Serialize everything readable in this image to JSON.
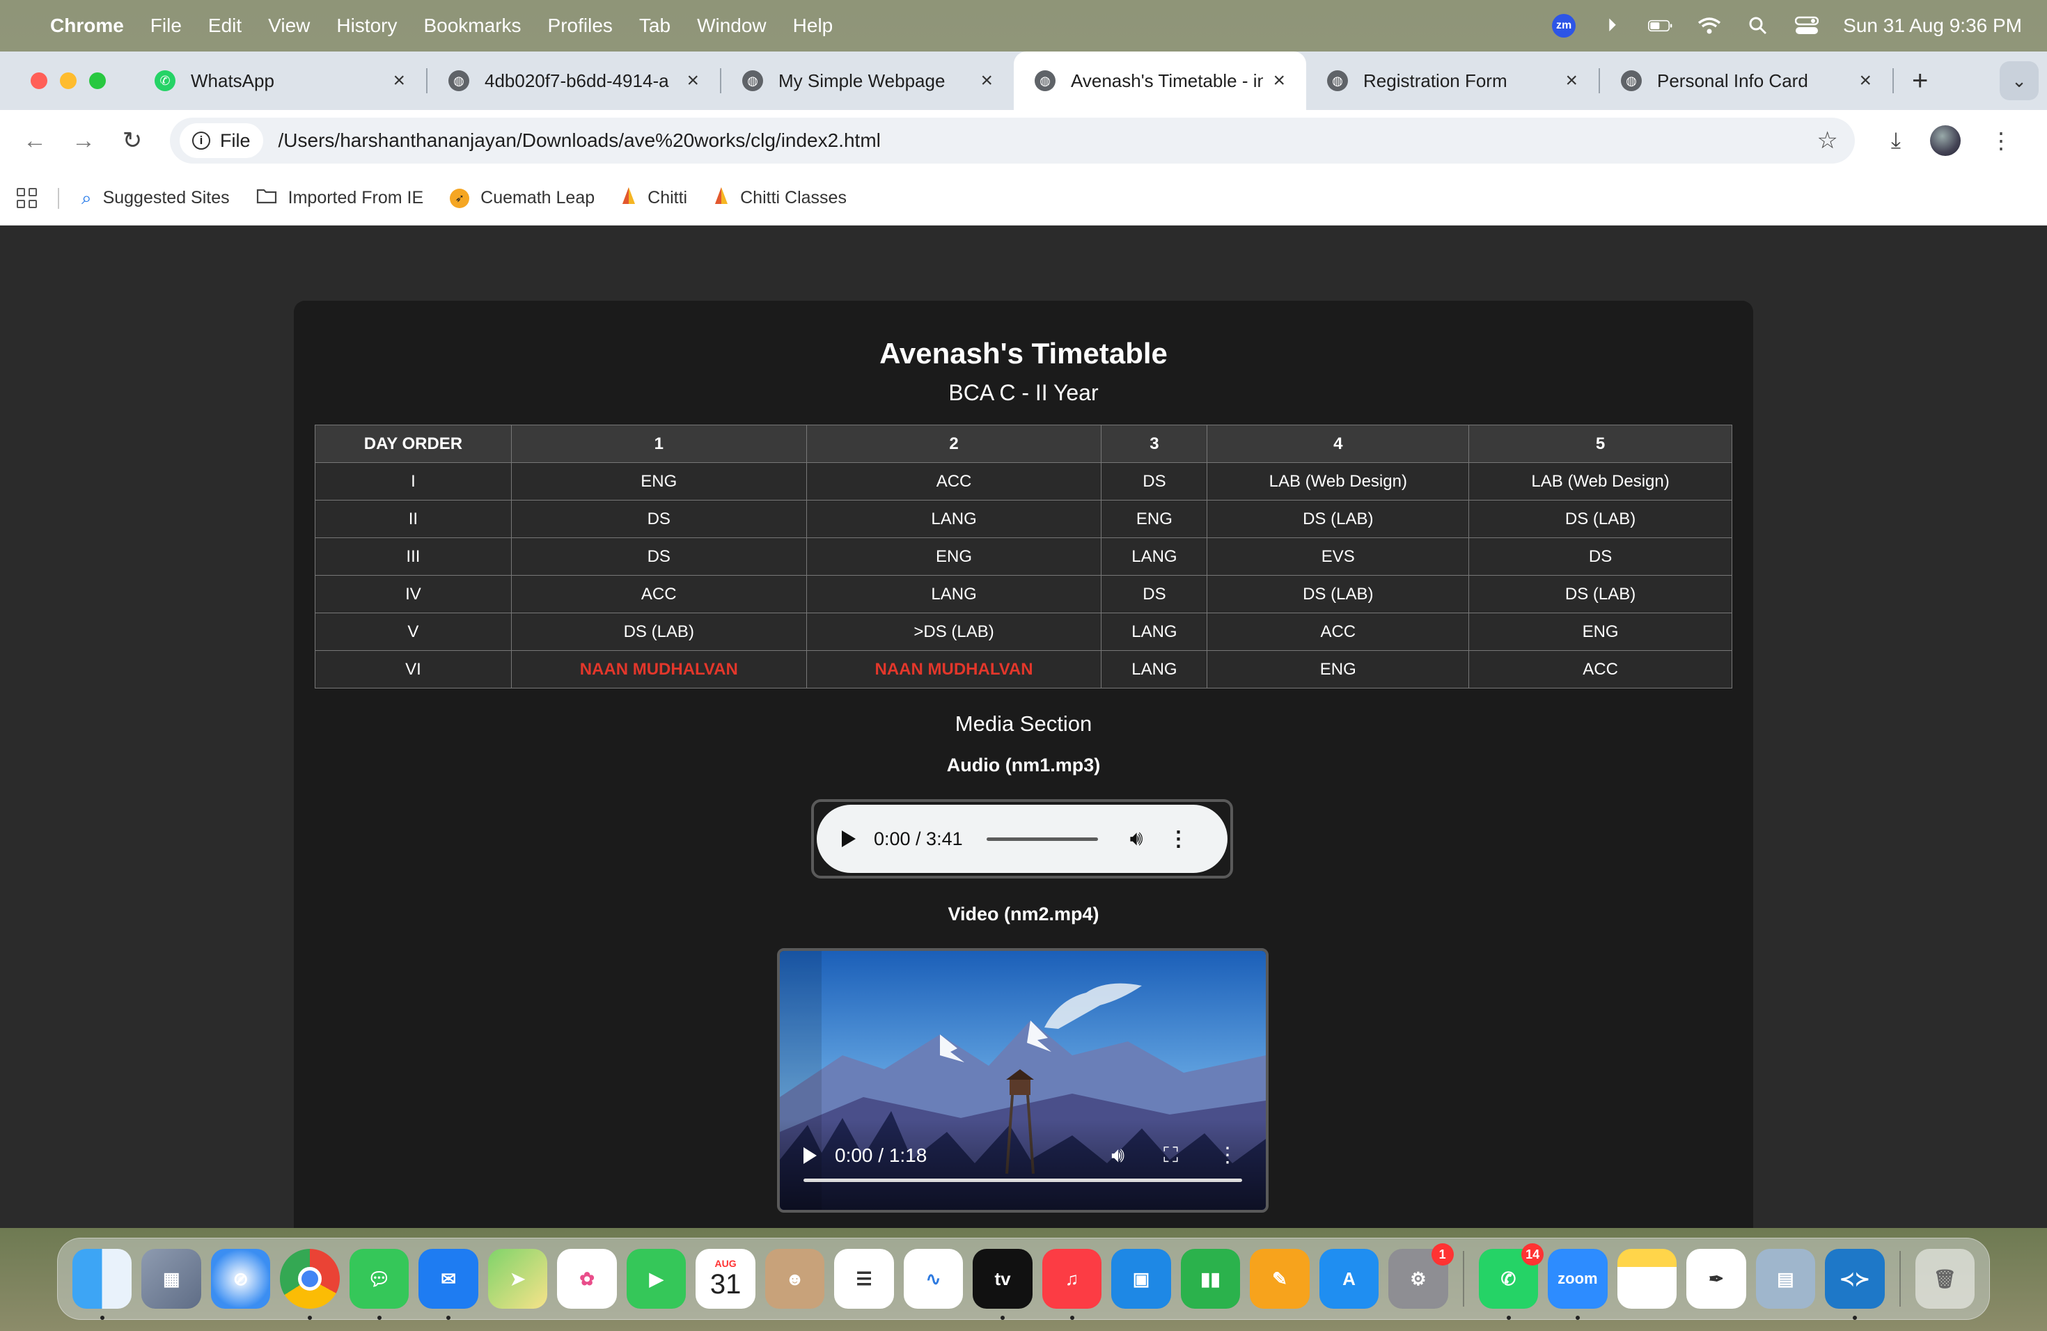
{
  "menubar": {
    "app_name": "Chrome",
    "items": [
      "File",
      "Edit",
      "View",
      "History",
      "Bookmarks",
      "Profiles",
      "Tab",
      "Window",
      "Help"
    ],
    "zoom_badge": "zm",
    "datetime": "Sun 31 Aug  9:36 PM"
  },
  "tabs": [
    {
      "title": "WhatsApp",
      "icon": "whatsapp-icon",
      "color": "#25d366"
    },
    {
      "title": "4db020f7-b6dd-4914-a",
      "icon": "globe-icon",
      "color": "#5f6368"
    },
    {
      "title": "My Simple Webpage",
      "icon": "globe-icon",
      "color": "#5f6368"
    },
    {
      "title": "Avenash's Timetable - in",
      "icon": "globe-icon",
      "color": "#5f6368"
    },
    {
      "title": "Registration Form",
      "icon": "globe-icon",
      "color": "#5f6368"
    },
    {
      "title": "Personal Info Card",
      "icon": "globe-icon",
      "color": "#5f6368"
    }
  ],
  "toolbar": {
    "chip_label": "File",
    "url": "/Users/harshanthananjayan/Downloads/ave%20works/clg/index2.html"
  },
  "bookmarks": [
    {
      "label": "Suggested Sites",
      "icon": "search-icon"
    },
    {
      "label": "Imported From IE",
      "icon": "folder-icon"
    },
    {
      "label": "Cuemath Leap",
      "icon": "rocket-icon"
    },
    {
      "label": "Chitti",
      "icon": "chitti-icon"
    },
    {
      "label": "Chitti Classes",
      "icon": "chitti-icon"
    }
  ],
  "page": {
    "title": "Avenash's Timetable",
    "subtitle": "BCA C - II Year",
    "table": {
      "headers": [
        "DAY ORDER",
        "1",
        "2",
        "3",
        "4",
        "5"
      ],
      "rows": [
        [
          "I",
          "ENG",
          "ACC",
          "DS",
          "LAB (Web Design)",
          "LAB (Web Design)"
        ],
        [
          "II",
          "DS",
          "LANG",
          "ENG",
          "DS (LAB)",
          "DS (LAB)"
        ],
        [
          "III",
          "DS",
          "ENG",
          "LANG",
          "EVS",
          "DS"
        ],
        [
          "IV",
          "ACC",
          "LANG",
          "DS",
          "DS (LAB)",
          "DS (LAB)"
        ],
        [
          "V",
          "DS (LAB)",
          ">DS (LAB)",
          "LANG",
          "ACC",
          "ENG"
        ],
        [
          "VI",
          "NAAN MUDHALVAN",
          "NAAN MUDHALVAN",
          "LANG",
          "ENG",
          "ACC"
        ]
      ],
      "highlight_color": "#e3372b"
    },
    "media_title": "Media Section",
    "audio": {
      "label": "Audio (nm1.mp3)",
      "time": "0:00 / 3:41"
    },
    "video": {
      "label": "Video (nm2.mp4)",
      "time": "0:00 / 1:18"
    }
  },
  "dock": {
    "apps": [
      "Finder",
      "Launchpad",
      "Safari",
      "Chrome",
      "Messages",
      "Mail",
      "Maps",
      "Photos",
      "FaceTime",
      "Calendar",
      "Contacts",
      "Reminders",
      "Freeform",
      "TV",
      "Music",
      "Keynote",
      "Numbers",
      "Pages",
      "App Store",
      "System Settings",
      "WhatsApp",
      "Zoom",
      "Notes",
      "TextEdit",
      "Preview",
      "VS Code",
      "Trash"
    ],
    "calendar_month": "AUG",
    "calendar_day": "31",
    "zoom_label": "zoom",
    "settings_badge": "1",
    "whatsapp_badge": "14"
  }
}
